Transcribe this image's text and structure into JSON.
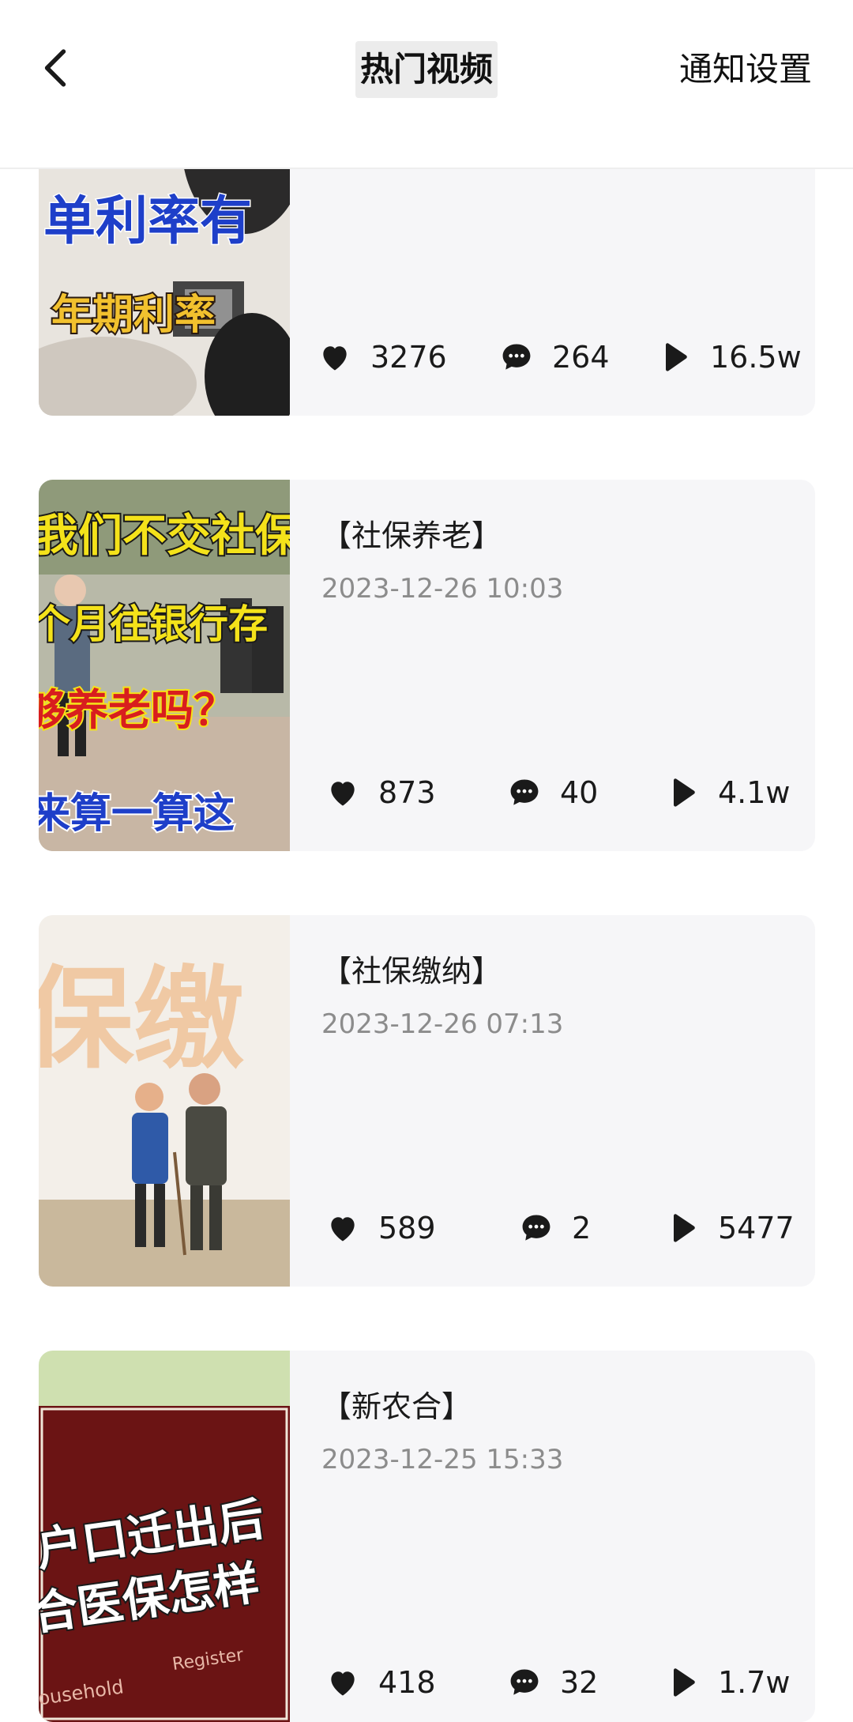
{
  "header": {
    "title": "热门视频",
    "right_link": "通知设置",
    "back_icon": "chevron-left-icon"
  },
  "colors": {
    "card_bg": "#f6f6f8",
    "date_text": "#8c8c8c",
    "icon": "#1a1a1a"
  },
  "icons": {
    "like": "heart-icon",
    "comment": "comment-bubble-icon",
    "plays": "play-icon"
  },
  "videos": [
    {
      "title": "",
      "date": "",
      "likes": "3276",
      "comments": "264",
      "plays": "16.5w",
      "thumb_text": [
        "单利率有",
        "年期利率"
      ]
    },
    {
      "title": "【社保养老】",
      "date": "2023-12-26 10:03",
      "likes": "873",
      "comments": "40",
      "plays": "4.1w",
      "thumb_text": [
        "我们不交社保",
        "个月往银行存",
        "够养老吗？",
        "来算一算这"
      ]
    },
    {
      "title": "【社保缴纳】",
      "date": "2023-12-26 07:13",
      "likes": "589",
      "comments": "2",
      "plays": "5477",
      "thumb_text": [
        "保缴"
      ]
    },
    {
      "title": "【新农合】",
      "date": "2023-12-25 15:33",
      "likes": "418",
      "comments": "32",
      "plays": "1.7w",
      "thumb_text": [
        "户口迁出后",
        "合医保怎样",
        "Register",
        "ousehold"
      ]
    }
  ]
}
